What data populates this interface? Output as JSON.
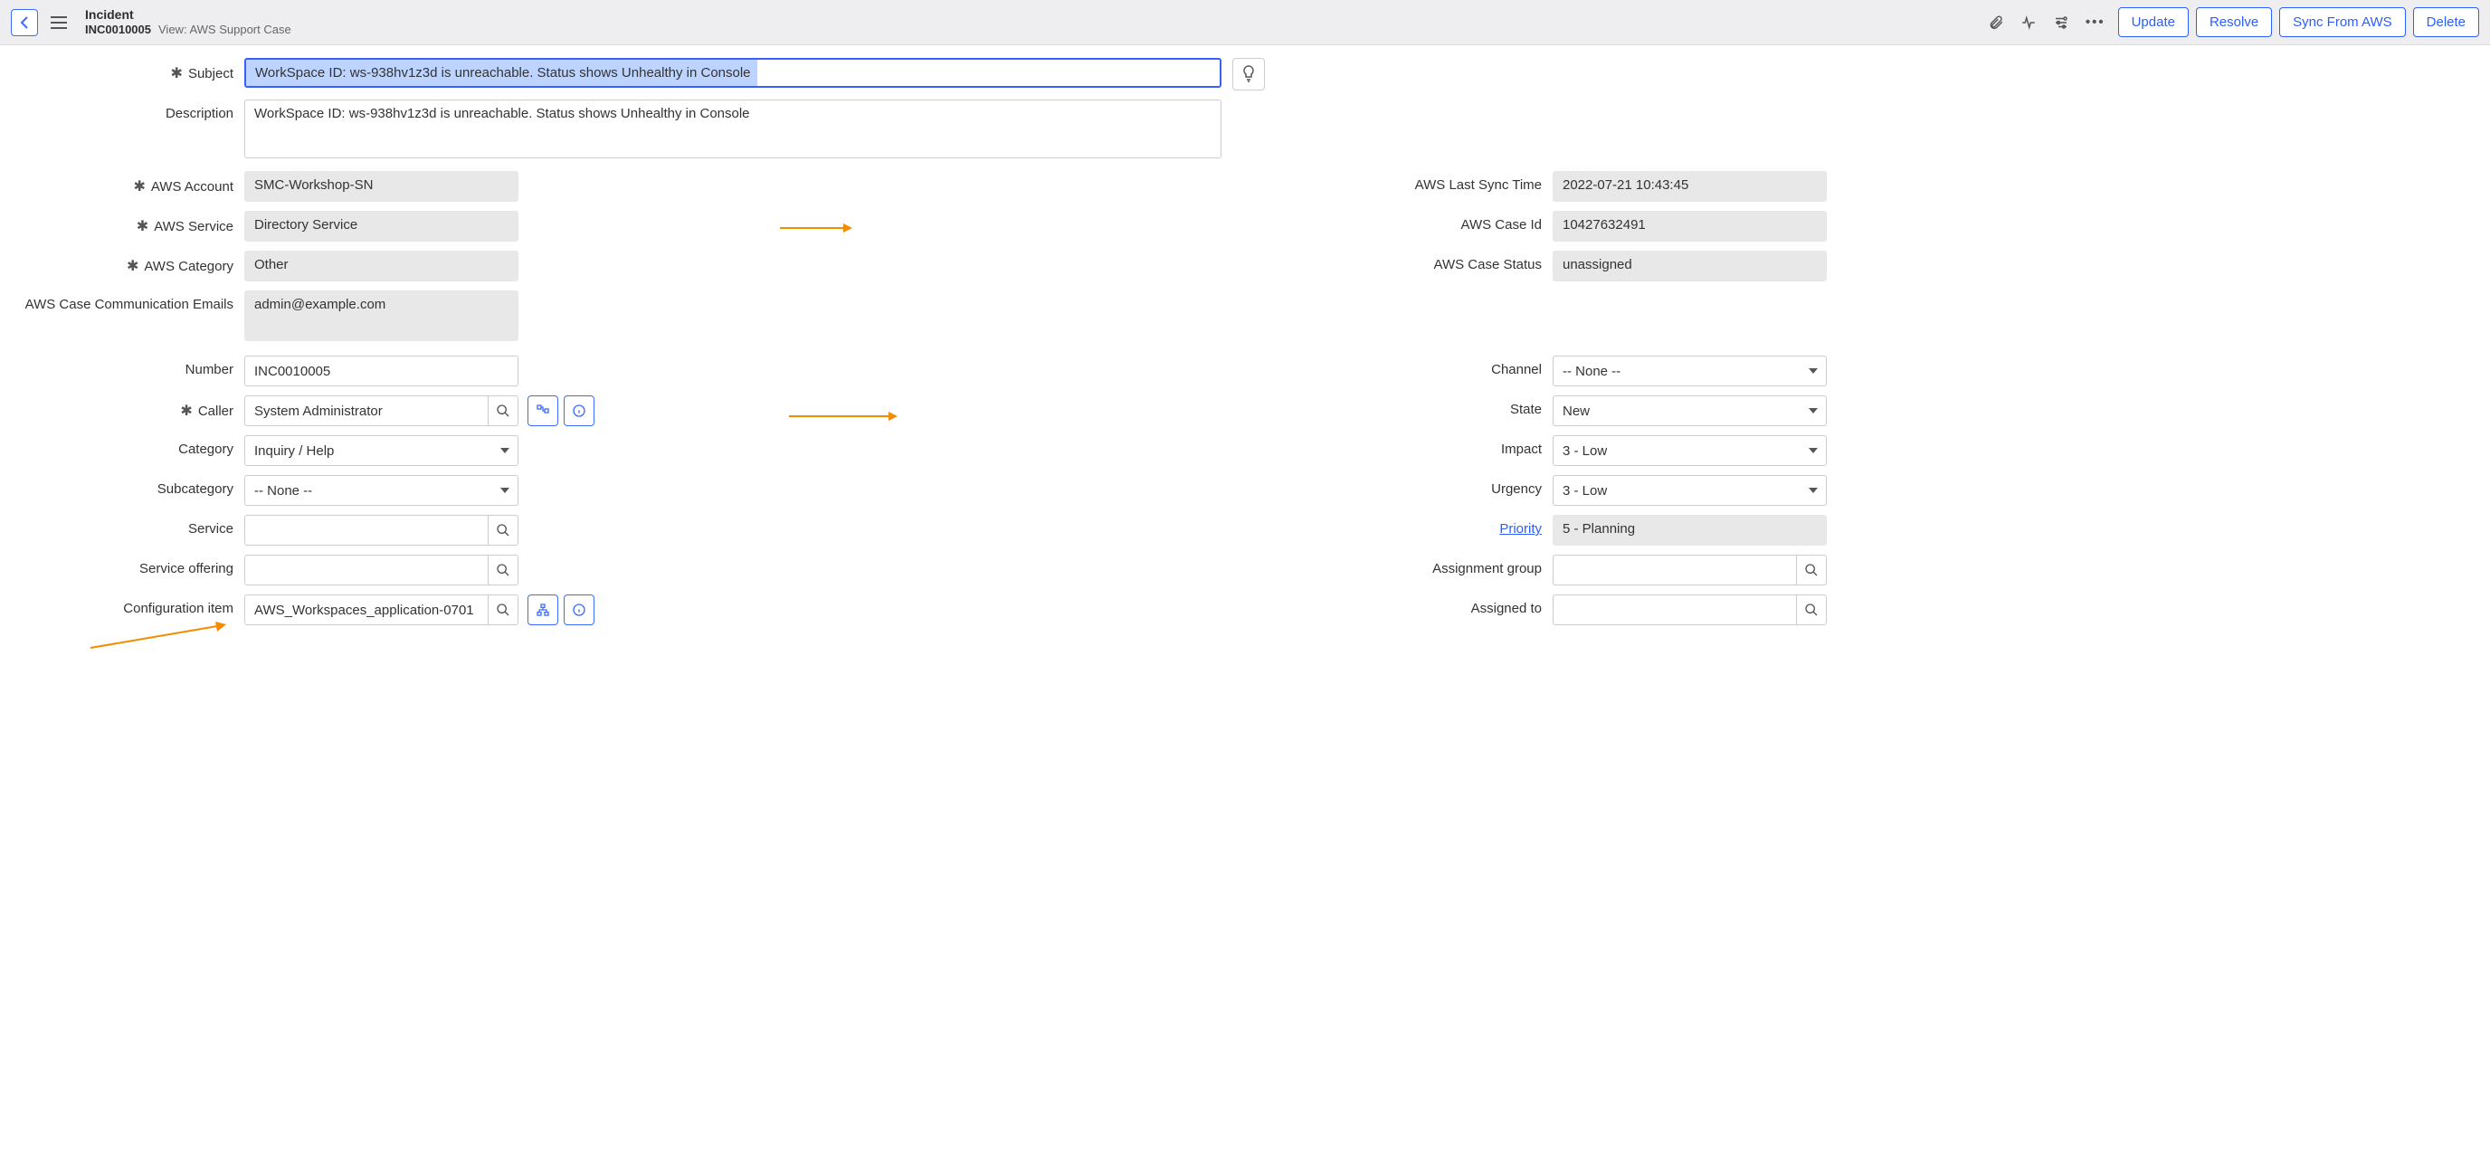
{
  "header": {
    "record_type": "Incident",
    "record_number": "INC0010005",
    "view_prefix": "View:",
    "view_name": "AWS Support Case",
    "buttons": {
      "update": "Update",
      "resolve": "Resolve",
      "sync": "Sync From AWS",
      "delete": "Delete"
    }
  },
  "labels": {
    "subject": "Subject",
    "description": "Description",
    "aws_account": "AWS Account",
    "aws_service": "AWS Service",
    "aws_category": "AWS Category",
    "aws_emails": "AWS Case Communication Emails",
    "aws_last_sync": "AWS Last Sync Time",
    "aws_case_id": "AWS Case Id",
    "aws_case_status": "AWS Case Status",
    "number": "Number",
    "caller": "Caller",
    "category": "Category",
    "subcategory": "Subcategory",
    "service": "Service",
    "service_offering": "Service offering",
    "config_item": "Configuration item",
    "channel": "Channel",
    "state": "State",
    "impact": "Impact",
    "urgency": "Urgency",
    "priority": "Priority",
    "assignment_group": "Assignment group",
    "assigned_to": "Assigned to"
  },
  "values": {
    "subject": "WorkSpace ID: ws-938hv1z3d is unreachable. Status shows Unhealthy in Console",
    "description": "WorkSpace ID: ws-938hv1z3d is unreachable. Status shows Unhealthy in Console",
    "aws_account": "SMC-Workshop-SN",
    "aws_service": "Directory Service",
    "aws_category": "Other",
    "aws_emails": "admin@example.com",
    "aws_last_sync": "2022-07-21 10:43:45",
    "aws_case_id": "10427632491",
    "aws_case_status": "unassigned",
    "number": "INC0010005",
    "caller": "System Administrator",
    "category": "Inquiry / Help",
    "subcategory": "-- None --",
    "service": "",
    "service_offering": "",
    "config_item": "AWS_Workspaces_application-0701",
    "channel": "-- None --",
    "state": "New",
    "impact": "3 - Low",
    "urgency": "3 - Low",
    "priority": "5 - Planning",
    "assignment_group": "",
    "assigned_to": ""
  }
}
